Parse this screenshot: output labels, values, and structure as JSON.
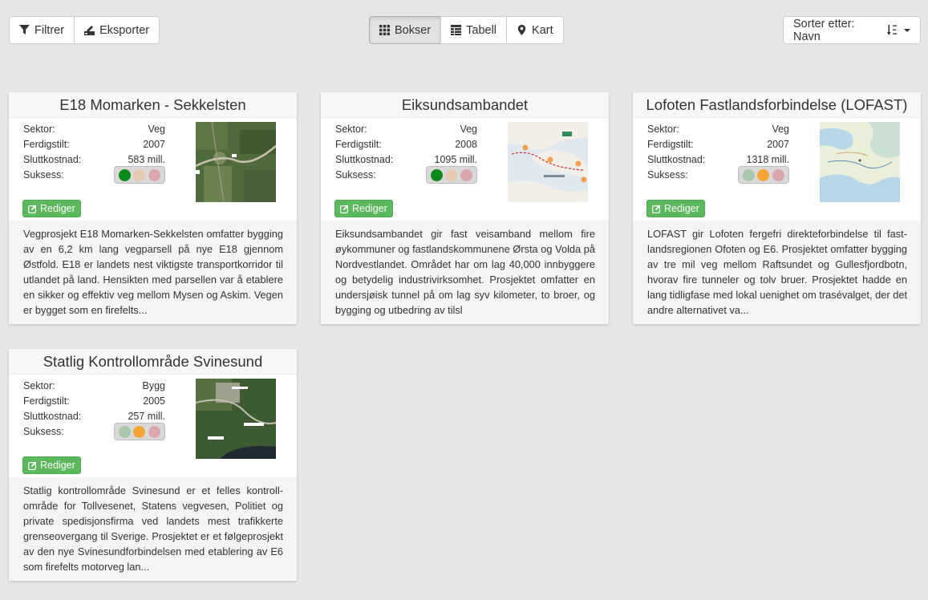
{
  "toolbar": {
    "filter_label": "Filtrer",
    "export_label": "Eksporter",
    "view_boxes_label": "Bokser",
    "view_table_label": "Tabell",
    "view_map_label": "Kart",
    "sort_label": "Sorter etter: Navn"
  },
  "labels": {
    "sector": "Sektor:",
    "completed": "Ferdigstilt:",
    "final_cost": "Sluttkostnad:",
    "success": "Suksess:",
    "edit": "Rediger"
  },
  "colors": {
    "green_on": "#0b8a1b",
    "green_off": "#a9c7a9",
    "yellow_on": "#f7a437",
    "yellow_off": "#e7c9b2",
    "red_off": "#dba7ad",
    "edit_button": "#5cb85c"
  },
  "projects": [
    {
      "title": "E18 Momarken - Sekkelsten",
      "sector": "Veg",
      "completed": "2007",
      "cost": "583 mill.",
      "success": "green",
      "image": "aerial-photo",
      "description": "Vegprosjekt E18 Momarken-Sekkelsten omfatter byg­ging av en 6,2 km lang vegparsell på nye E18 gjen­nom Østfold. E18 er landets nest viktigste transport­korridor til utlandet på land. Hensikten med parsellen var å etablere en sikker og effektiv veg mellom Mysen og Askim. Vegen er bygget som en firefelts..."
    },
    {
      "title": "Eiksundsambandet",
      "sector": "Veg",
      "completed": "2008",
      "cost": "1095 mill.",
      "success": "green",
      "image": "route-map",
      "description": "Eiksundsambandet gir fast veisamband mellom fire øykommuner og fastlandskommunene Ørsta og Vol­da på Nordvestlandet. Området har om lag 40,000 innbyggere og betydelig industrivirksomhet. Prosjek­tet omfatter en undersjøisk tunnel på om lag syv kilo­meter, to broer, og bygging og utbedring av tilsl"
    },
    {
      "title": "Lofoten Fastlandsforbindelse (LOFAST)",
      "sector": "Veg",
      "completed": "2007",
      "cost": "1318 mill.",
      "success": "yellow",
      "image": "topo-map",
      "description": "LOFAST gir Lofoten fergefri direkteforbindelse til fast­landsregionen Ofoten og E6. Prosjektet omfatter byg­ging av tre mil veg mellom Raftsundet og Gullesfjord­botn, hvorav fire tunneler og tolv bruer. Prosjektet hadde en lang tidligfase med lokal uenighet om trasé­valget, der det andre alternativet va..."
    },
    {
      "title": "Statlig Kontrollområde Svinesund",
      "sector": "Bygg",
      "completed": "2005",
      "cost": "257 mill.",
      "success": "yellow",
      "image": "aerial-map",
      "description": "Statlig kontrollområde Svinesund er et felles kontroll­område for Tollvesenet, Statens vegvesen, Politiet og private spedisjonsfirma ved landets mest trafikkerte grenseovergang til Sverige. Prosjektet er et følgepro­sjekt av den nye Svinesundforbindelsen med etable­ring av E6 som firefelts motorveg lan..."
    }
  ]
}
